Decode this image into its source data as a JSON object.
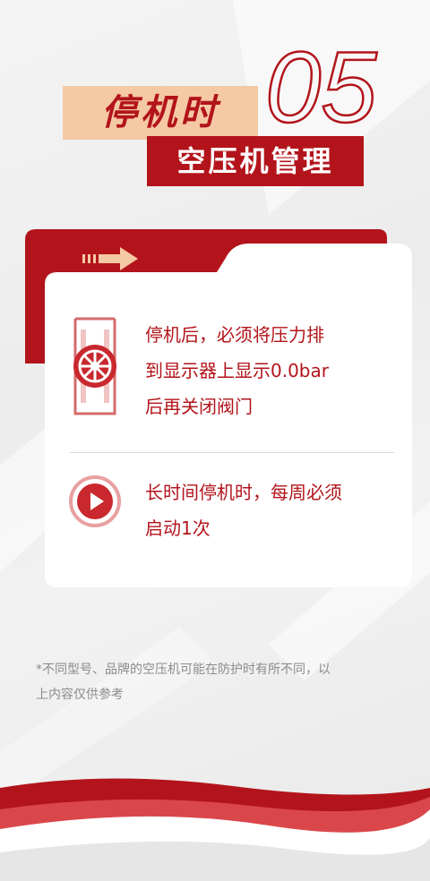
{
  "header": {
    "number": "05",
    "title_primary": "停机时",
    "title_secondary": "空压机管理"
  },
  "card": {
    "items": [
      {
        "icon": "valve-icon",
        "lines": [
          "停机后，必须将压力排",
          "到显示器上显示0.0bar",
          "后再关闭阀门"
        ]
      },
      {
        "icon": "play-icon",
        "lines": [
          "长时间停机时，每周必须",
          "启动1次"
        ]
      }
    ]
  },
  "footnote": {
    "lines": [
      "*不同型号、品牌的空压机可能在防护时有所不同，以",
      "上内容仅供参考"
    ]
  },
  "colors": {
    "brand_red": "#b3141b",
    "title_tan": "#f5c9a3",
    "footnote_gray": "#8c8c8c"
  }
}
